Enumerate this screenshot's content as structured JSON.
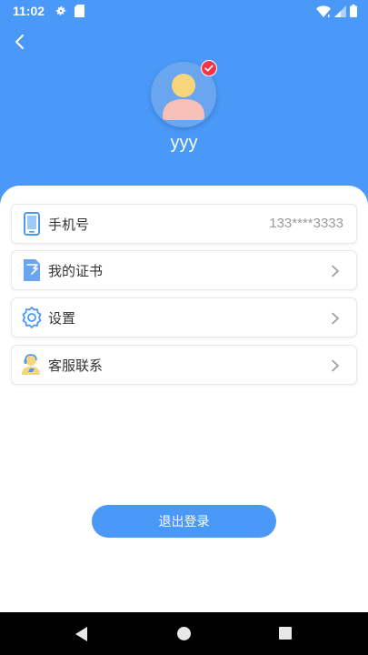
{
  "status_bar": {
    "time": "11:02",
    "icons": [
      "gear-icon",
      "sd-card-icon",
      "wifi-icon",
      "signal-icon",
      "battery-icon"
    ]
  },
  "header": {
    "back_icon": "back-arrow-icon",
    "username": "yyy",
    "avatar_icon": "user-avatar-icon",
    "badge_icon": "check-badge-icon"
  },
  "menu": {
    "items": [
      {
        "label": "手机号",
        "value": "133****3333",
        "icon": "phone-icon"
      },
      {
        "label": "我的证书",
        "icon": "certificate-icon"
      },
      {
        "label": "设置",
        "icon": "settings-icon"
      },
      {
        "label": "客服联系",
        "icon": "customer-service-icon"
      }
    ]
  },
  "actions": {
    "logout_label": "退出登录"
  },
  "colors": {
    "primary": "#4a98f8",
    "badge": "#f0384a",
    "text": "#333333",
    "muted": "#9a9a9a"
  }
}
